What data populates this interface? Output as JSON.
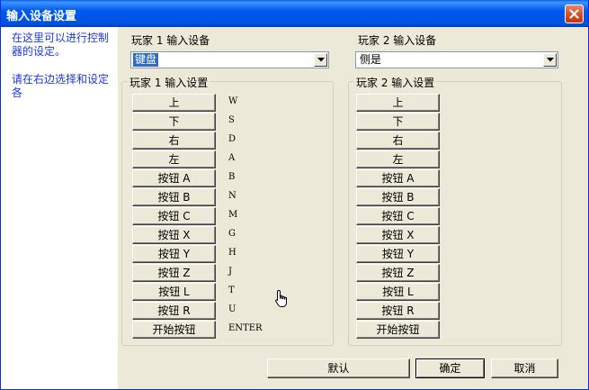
{
  "window": {
    "title": "输入设备设置"
  },
  "hints": [
    "在这里可以进行控制器的设定。",
    "请在右边选择和设定各"
  ],
  "player1": {
    "device_label": "玩家 1 输入设备",
    "device_value": "键盘",
    "group_label": "玩家 1 输入设置",
    "buttons": [
      "上",
      "下",
      "右",
      "左",
      "按钮 A",
      "按钮 B",
      "按钮 C",
      "按钮 X",
      "按钮 Y",
      "按钮 Z",
      "按钮 L",
      "按钮 R",
      "开始按钮"
    ],
    "keys": [
      "W",
      "S",
      "D",
      "A",
      "B",
      "N",
      "M",
      "G",
      "H",
      "J",
      "T",
      "U",
      "ENTER"
    ]
  },
  "player2": {
    "device_label": "玩家 2 输入设备",
    "device_value": "侧是",
    "group_label": "玩家 2 输入设置",
    "buttons": [
      "上",
      "下",
      "右",
      "左",
      "按钮 A",
      "按钮 B",
      "按钮 C",
      "按钮 X",
      "按钮 Y",
      "按钮 Z",
      "按钮 L",
      "按钮 R",
      "开始按钮"
    ]
  },
  "footer": {
    "default_label": "默认",
    "ok_label": "确定",
    "cancel_label": "取消"
  },
  "icons": {
    "close": "close-icon",
    "dropdown": "chevron-down-icon",
    "cursor": "hand-pointer-icon"
  }
}
